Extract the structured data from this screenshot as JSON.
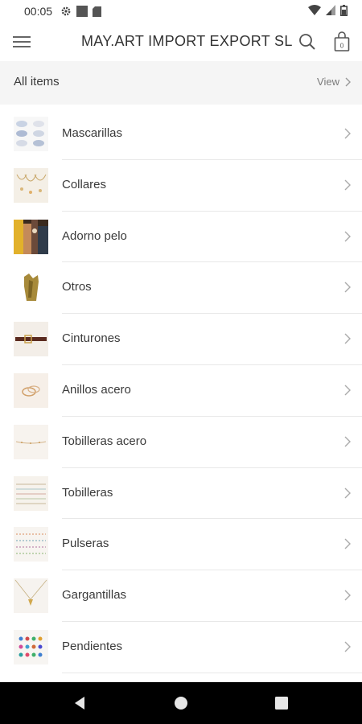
{
  "status_bar": {
    "time": "00:05",
    "icons": [
      "settings-icon",
      "square-icon",
      "sd-card-icon",
      "wifi-icon",
      "signal-icon",
      "battery-icon"
    ]
  },
  "app_bar": {
    "title": "MAY.ART IMPORT EXPORT SL",
    "menu_icon": "hamburger-menu-icon",
    "search_icon": "search-icon",
    "cart_icon": "shopping-bag-icon",
    "cart_count": "0"
  },
  "all_items": {
    "label": "All items",
    "view_label": "View"
  },
  "categories": [
    {
      "label": "Mascarillas",
      "thumb": "masks"
    },
    {
      "label": "Collares",
      "thumb": "necklaces"
    },
    {
      "label": "Adorno pelo",
      "thumb": "hair"
    },
    {
      "label": "Otros",
      "thumb": "other"
    },
    {
      "label": "Cinturones",
      "thumb": "belt"
    },
    {
      "label": "Anillos acero",
      "thumb": "rings"
    },
    {
      "label": "Tobilleras acero",
      "thumb": "anklet-steel"
    },
    {
      "label": "Tobilleras",
      "thumb": "anklets"
    },
    {
      "label": "Pulseras",
      "thumb": "bracelets"
    },
    {
      "label": "Gargantillas",
      "thumb": "chokers"
    },
    {
      "label": "Pendientes",
      "thumb": "earrings"
    }
  ],
  "nav_bar": {
    "icons": [
      "back-icon",
      "home-icon",
      "recents-icon"
    ]
  },
  "colors": {
    "background": "#ffffff",
    "header_band": "#f5f5f5",
    "text": "#3a3a3a",
    "muted": "#7a7a7a",
    "divider": "#e8e8e8",
    "nav_bar": "#000000"
  }
}
